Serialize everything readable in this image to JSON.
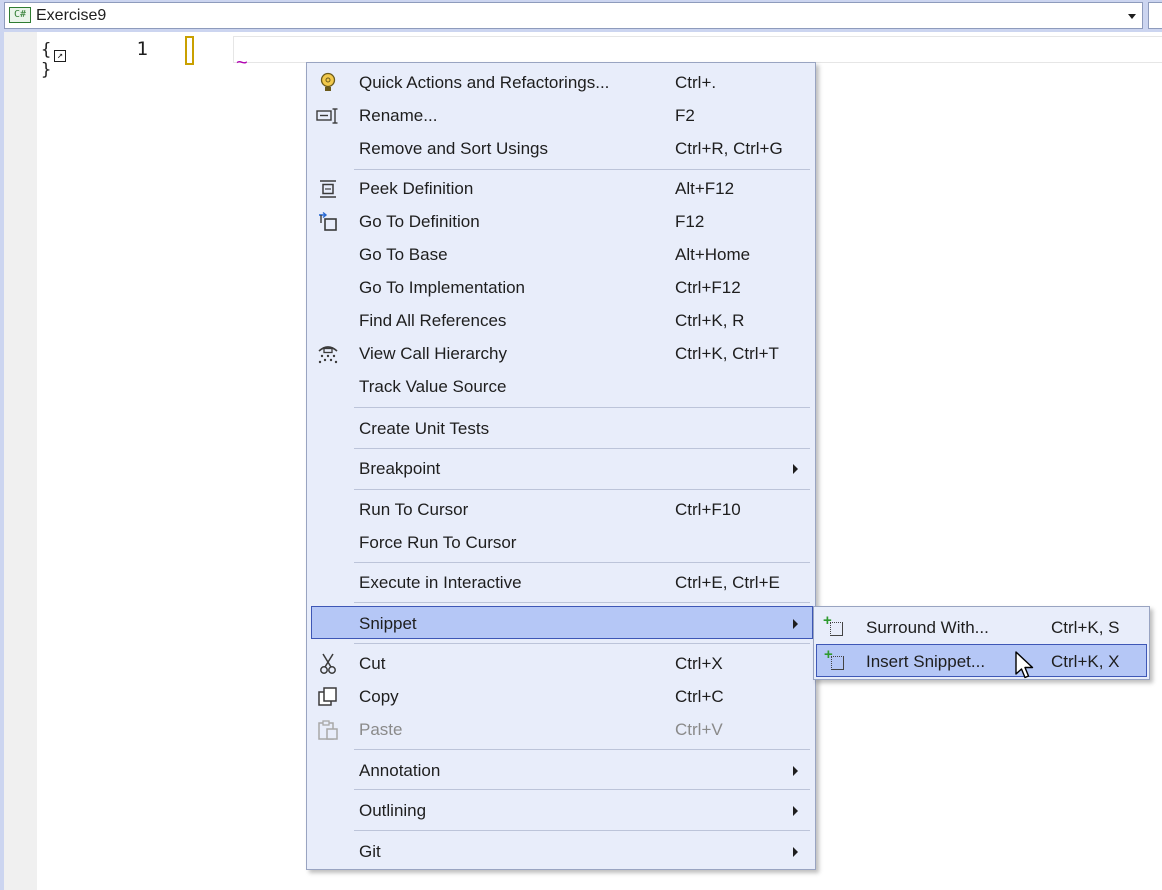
{
  "navbar": {
    "language_badge": "C#",
    "project": "Exercise9"
  },
  "editor": {
    "line_number": "1",
    "braces_glyph": "{ }",
    "squiggle_glyph": "~"
  },
  "context_menu": {
    "items": [
      {
        "label": "Quick Actions and Refactorings...",
        "shortcut": "Ctrl+.",
        "icon": "lightbulb-icon"
      },
      {
        "label": "Rename...",
        "shortcut": "F2",
        "icon": "rename-icon"
      },
      {
        "label": "Remove and Sort Usings",
        "shortcut": "Ctrl+R, Ctrl+G"
      },
      {
        "label": "Peek Definition",
        "shortcut": "Alt+F12",
        "icon": "peek-definition-icon"
      },
      {
        "label": "Go To Definition",
        "shortcut": "F12",
        "icon": "go-to-definition-icon"
      },
      {
        "label": "Go To Base",
        "shortcut": "Alt+Home"
      },
      {
        "label": "Go To Implementation",
        "shortcut": "Ctrl+F12"
      },
      {
        "label": "Find All References",
        "shortcut": "Ctrl+K, R"
      },
      {
        "label": "View Call Hierarchy",
        "shortcut": "Ctrl+K, Ctrl+T",
        "icon": "call-hierarchy-icon"
      },
      {
        "label": "Track Value Source",
        "shortcut": ""
      },
      {
        "label": "Create Unit Tests",
        "shortcut": ""
      },
      {
        "label": "Breakpoint",
        "shortcut": "",
        "submenu": true
      },
      {
        "label": "Run To Cursor",
        "shortcut": "Ctrl+F10"
      },
      {
        "label": "Force Run To Cursor",
        "shortcut": ""
      },
      {
        "label": "Execute in Interactive",
        "shortcut": "Ctrl+E, Ctrl+E"
      },
      {
        "label": "Snippet",
        "shortcut": "",
        "submenu": true,
        "highlighted": true
      },
      {
        "label": "Cut",
        "shortcut": "Ctrl+X",
        "icon": "scissors-icon"
      },
      {
        "label": "Copy",
        "shortcut": "Ctrl+C",
        "icon": "copy-icon"
      },
      {
        "label": "Paste",
        "shortcut": "Ctrl+V",
        "icon": "paste-icon",
        "disabled": true
      },
      {
        "label": "Annotation",
        "shortcut": "",
        "submenu": true
      },
      {
        "label": "Outlining",
        "shortcut": "",
        "submenu": true
      },
      {
        "label": "Git",
        "shortcut": "",
        "submenu": true
      }
    ]
  },
  "snippet_submenu": {
    "items": [
      {
        "label": "Surround With...",
        "shortcut": "Ctrl+K, S",
        "icon": "surround-with-icon"
      },
      {
        "label": "Insert Snippet...",
        "shortcut": "Ctrl+K, X",
        "icon": "insert-snippet-icon",
        "highlighted": true
      }
    ]
  },
  "colors": {
    "navbar_bg": "#ccd5f0",
    "menu_bg": "#e8edfa",
    "highlight_bg": "#b5c7f6",
    "highlight_border": "#3e57b6",
    "disabled_text": "#8a8a8a"
  }
}
